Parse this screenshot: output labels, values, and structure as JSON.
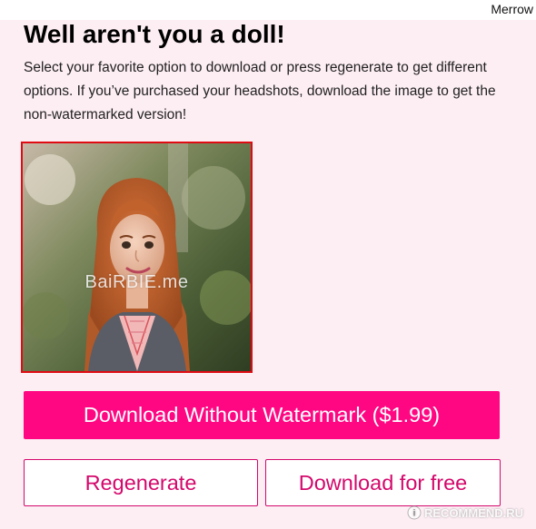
{
  "header": {
    "user_name": "Merrow"
  },
  "main": {
    "title": "Well aren't you a doll!",
    "description": "Select your favorite option to download or press regenerate to get different options. If you’ve purchased your headshots, download the image to get the non-watermarked version!",
    "image": {
      "watermark_text": "BaiRBIE.me",
      "border_color": "#e00b12"
    },
    "buttons": {
      "download_paid_label": "Download Without Watermark ($1.99)",
      "regenerate_label": "Regenerate",
      "download_free_label": "Download for free"
    }
  },
  "overlay": {
    "site_stamp": "RECOMMEND.RU"
  },
  "colors": {
    "background": "#fdeef4",
    "primary": "#ff0783",
    "outline": "#d4086c"
  }
}
